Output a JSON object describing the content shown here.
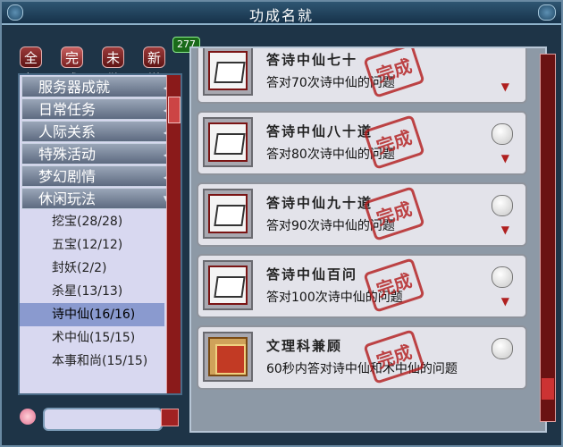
{
  "window": {
    "title": "功成名就"
  },
  "tabs": [
    {
      "label": "全部"
    },
    {
      "label": "完成"
    },
    {
      "label": "未做"
    },
    {
      "label": "新增"
    }
  ],
  "new_count": "277",
  "categories": [
    {
      "label": "服务器成就"
    },
    {
      "label": "日常任务"
    },
    {
      "label": "人际关系"
    },
    {
      "label": "特殊活动"
    },
    {
      "label": "梦幻剧情"
    },
    {
      "label": "休闲玩法"
    }
  ],
  "subitems": [
    {
      "label": "挖宝(28/28)"
    },
    {
      "label": "五宝(12/12)"
    },
    {
      "label": "封妖(2/2)"
    },
    {
      "label": "杀星(13/13)"
    },
    {
      "label": "诗中仙(16/16)",
      "selected": true
    },
    {
      "label": "术中仙(15/15)"
    },
    {
      "label": "本事和尚(15/15)"
    }
  ],
  "achievements": [
    {
      "title": "答诗中仙七十",
      "desc": "答对70次诗中仙的问题",
      "stamp": "完成",
      "icon": "book-icon"
    },
    {
      "title": "答诗中仙八十道",
      "desc": "答对80次诗中仙的问题",
      "stamp": "完成",
      "icon": "book-icon"
    },
    {
      "title": "答诗中仙九十道",
      "desc": "答对90次诗中仙的问题",
      "stamp": "完成",
      "icon": "book-icon"
    },
    {
      "title": "答诗中仙百问",
      "desc": "答对100次诗中仙的问题",
      "stamp": "完成",
      "icon": "book-icon"
    },
    {
      "title": "文理科兼顾",
      "desc": "60秒内答对诗中仙和术中仙的问题",
      "stamp": "完成",
      "icon": "red-book-icon"
    }
  ],
  "colors": {
    "accent": "#b31b1b",
    "panel": "#d8d8f0",
    "window": "#1e3447"
  }
}
